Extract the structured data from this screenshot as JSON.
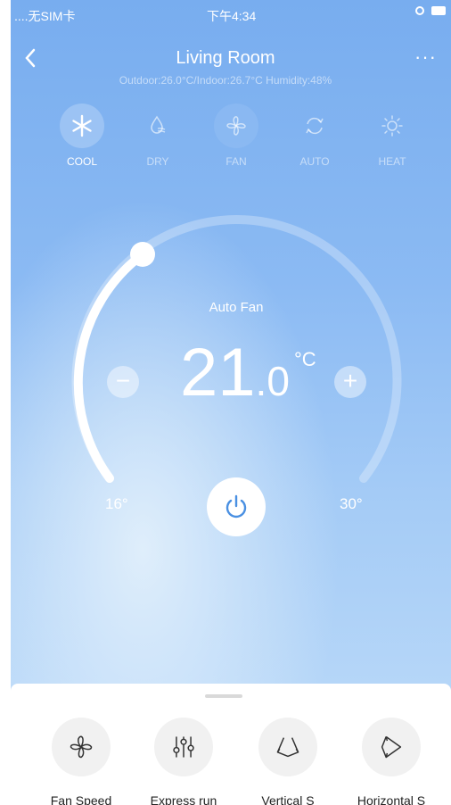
{
  "status_bar": {
    "carrier": "....无SIM卡",
    "time": "下午4:34"
  },
  "header": {
    "title": "Living Room",
    "subtitle": "Outdoor:26.0°C/Indoor:26.7°C Humidity:48%",
    "back_icon": "chevron-left-icon",
    "more_icon": "more-dots-icon"
  },
  "modes": [
    {
      "label": "COOL",
      "icon": "snowflake-icon",
      "active": true
    },
    {
      "label": "DRY",
      "icon": "droplet-icon",
      "active": false
    },
    {
      "label": "FAN",
      "icon": "fan-icon",
      "active": false
    },
    {
      "label": "AUTO",
      "icon": "auto-cycle-icon",
      "active": false
    },
    {
      "label": "HEAT",
      "icon": "sun-icon",
      "active": false
    }
  ],
  "thermostat": {
    "fan_mode": "Auto Fan",
    "temp_int": "21",
    "temp_dec": ".0",
    "unit": "°C",
    "min_label": "16°",
    "max_label": "30°",
    "min": 16,
    "max": 30,
    "value": 21.0,
    "minus": "−",
    "plus": "+"
  },
  "actions": [
    {
      "label": "Fan Speed",
      "icon": "fan-icon"
    },
    {
      "label": "Express run",
      "icon": "sliders-icon"
    },
    {
      "label": "Vertical S",
      "icon": "vertical-swing-icon"
    },
    {
      "label": "Horizontal S",
      "icon": "horizontal-swing-icon"
    }
  ],
  "colors": {
    "accent": "#4a90e2",
    "bg_top": "#78adef",
    "bg_bottom": "#b7d7f8"
  }
}
